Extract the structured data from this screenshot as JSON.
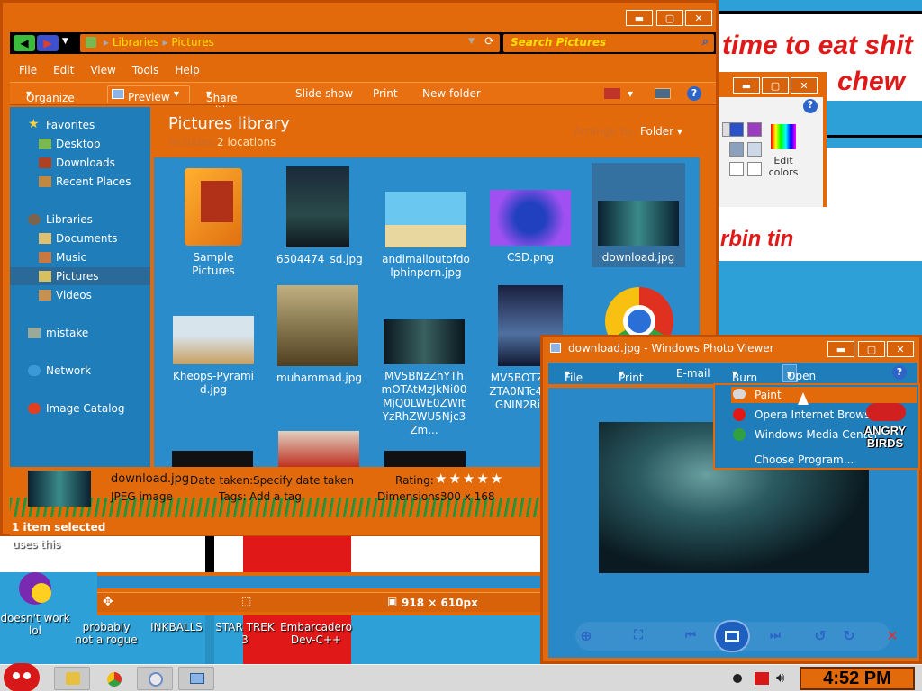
{
  "background_paint": {
    "line1": "time to eat shit",
    "line2": "chew",
    "line3": "rbin  tin"
  },
  "explorer": {
    "window_buttons": {
      "minimize": "▬",
      "maximize": "▢",
      "close": "✕"
    },
    "address": {
      "crumbs": [
        "Libraries",
        "Pictures"
      ]
    },
    "search_placeholder": "Search Pictures",
    "menu": [
      "File",
      "Edit",
      "View",
      "Tools",
      "Help"
    ],
    "toolbar": {
      "organize": "Organize",
      "preview": "Preview",
      "share_with": "Share with",
      "slide_show": "Slide show",
      "print": "Print",
      "new_folder": "New folder"
    },
    "nav": {
      "favorites": "Favorites",
      "desktop": "Desktop",
      "downloads": "Downloads",
      "recent_places": "Recent Places",
      "libraries": "Libraries",
      "documents": "Documents",
      "music": "Music",
      "pictures": "Pictures",
      "videos": "Videos",
      "mistake": "mistake",
      "network": "Network",
      "image_catalog": "Image Catalog"
    },
    "library": {
      "title": "Pictures library",
      "includes": "Includes:",
      "locations": "2 locations",
      "arrange_by_label": "Arrange by:",
      "arrange_by_value": "Folder"
    },
    "files": [
      {
        "name": "Sample Pictures"
      },
      {
        "name": "6504474_sd.jpg"
      },
      {
        "name": "andimalloutofdolphinporn.jpg"
      },
      {
        "name": "CSD.png"
      },
      {
        "name": "download.jpg"
      },
      {
        "name": "Kheops-Pyramid.jpg"
      },
      {
        "name": "muhammad.jpg"
      },
      {
        "name": "MV5BNzZhYThmOTAtMzJkNi00MjQ0LWE0ZWItYzRhZWU5Njc3Zm..."
      },
      {
        "name": "MV5BOTZjMTItZTA0NTc4LWJlZGNIN2RiMz..."
      }
    ],
    "details": {
      "filename": "download.jpg",
      "type": "JPEG image",
      "date_taken_label": "Date taken:",
      "date_taken_value": "Specify date taken",
      "tags_label": "Tags:",
      "tags_value": "Add a tag",
      "rating_label": "Rating:",
      "rating_stars": "★★★★★",
      "dimensions_label": "Dimensions:",
      "dimensions_value": "300 x 168"
    },
    "status": "1 item selected"
  },
  "strip": {
    "size": "918 × 610px"
  },
  "viewer": {
    "title": "download.jpg - Windows Photo Viewer",
    "menu": {
      "file": "File",
      "print": "Print",
      "email": "E-mail",
      "burn": "Burn",
      "open": "Open"
    },
    "open_menu": [
      "Paint",
      "Opera Internet Browser",
      "Windows Media Center",
      "Choose Program..."
    ]
  },
  "paint_window": {
    "edit_colors": "Edit colors"
  },
  "desktop": {
    "partial_label": "uses this",
    "icons": [
      "doesn't work lol",
      "probably not a rogue",
      "INKBALLS",
      "STAR TREK 3",
      "Embarcadero Dev-C++"
    ],
    "angry_birds": "ANGRY BIRDS"
  },
  "taskbar": {
    "clock": "4:52 PM"
  },
  "colors": {
    "accent": "#e26a0a",
    "pane_blue": "#1f7db9",
    "content_blue": "#2b8ccb",
    "highlight_yellow": "#ffe000"
  }
}
